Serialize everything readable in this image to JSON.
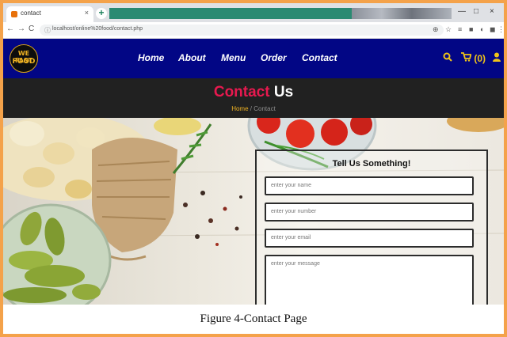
{
  "browser": {
    "tab_title": "contact",
    "tab_close": "×",
    "new_tab": "+",
    "window_controls": [
      "—",
      "□",
      "×"
    ],
    "back": "←",
    "forward": "→",
    "reload": "C",
    "url": "localhost/online%20food/contact.php",
    "extension_icons": [
      "⊕",
      "☆",
      "≡",
      "■",
      "◐",
      "◼",
      "⋮"
    ]
  },
  "site": {
    "logo_line1": "WE FAST",
    "logo_line2": "FOOD",
    "nav": [
      "Home",
      "About",
      "Menu",
      "Order",
      "Contact"
    ],
    "search_icon": "search-icon",
    "cart_label": "(0)",
    "user_icon": "user-icon",
    "accent": "#e8194f",
    "nav_bg": "#020685"
  },
  "banner": {
    "title_accent": "Contact",
    "title_rest": "Us",
    "breadcrumb_home": "Home",
    "breadcrumb_sep": "/",
    "breadcrumb_current": "Contact"
  },
  "form": {
    "title": "Tell Us Something!",
    "name_placeholder": "enter your name",
    "number_placeholder": "enter your number",
    "email_placeholder": "enter your email",
    "message_placeholder": "enter your message"
  },
  "caption": "Figure 4-Contact Page"
}
